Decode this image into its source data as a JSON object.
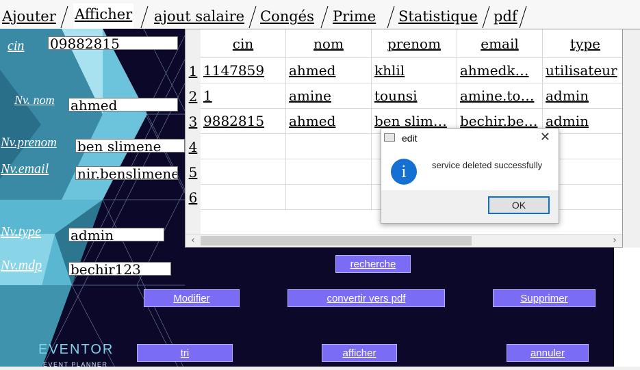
{
  "tabs": [
    "Ajouter",
    "Afficher",
    "ajout salaire",
    "Congés",
    " Prime",
    "Statistique",
    "pdf"
  ],
  "active_tab": "Afficher",
  "form": {
    "cin_label": "cin",
    "cin_value": "09882815",
    "nom_label": "Nv. nom",
    "nom_value": "ahmed",
    "prenom_label": "Nv.prenom",
    "prenom_value": "ben slimene",
    "email_label": "Nv.email",
    "email_value": "nir.benslimene",
    "type_label": "Nv.type",
    "type_value": "admin",
    "mdp_label": "Nv.mdp",
    "mdp_value": "bechir123"
  },
  "table": {
    "columns": [
      "cin",
      "nom",
      "prenom",
      "email",
      "type"
    ],
    "row_numbers": [
      "1",
      "2",
      "3",
      "4",
      "5",
      "6"
    ],
    "rows": [
      [
        "1147859",
        "ahmed",
        "khlil",
        "ahmedk…",
        "utilisateur"
      ],
      [
        "1",
        "amine",
        "tounsi",
        "amine.to…",
        "admin"
      ],
      [
        "9882815",
        "ahmed",
        "ben slim…",
        "bechir.be…",
        "admin"
      ]
    ]
  },
  "buttons": {
    "recherche": "recherche",
    "modifier": "Modifier",
    "convertir": "convertir vers pdf",
    "supprimer": "Supprimer",
    "tri": "tri",
    "afficher": "afficher",
    "annuler": "annuler"
  },
  "logo": {
    "title": "EVENTOR",
    "subtitle": "EVENT PLANNER"
  },
  "dialog": {
    "title": "edit",
    "message": "service deleted successfully",
    "ok_label": "OK",
    "close_glyph": "✕",
    "info_glyph": "i"
  },
  "scroll": {
    "left_arrow": "‹",
    "right_arrow": "›"
  },
  "colors": {
    "button_bg": "#7b6cf6",
    "dark_bg": "#0b0829",
    "info_blue": "#1470d2",
    "logo": "#7fd2e8"
  }
}
